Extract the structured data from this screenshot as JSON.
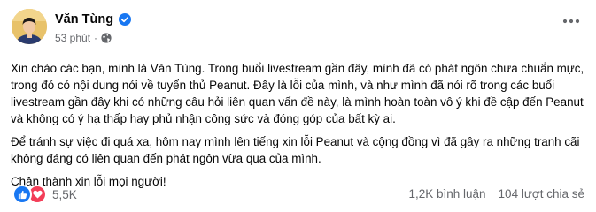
{
  "post": {
    "author": "Văn Tùng",
    "time": "53 phút",
    "separator": "·",
    "paragraphs": [
      "Xin chào các bạn, mình là Văn Tùng. Trong buổi livestream gần đây, mình đã có phát ngôn chưa chuẩn mực, trong đó có nội dung nói về tuyển thủ Peanut. Đây là lỗi của mình, và như mình đã nói rõ trong các buổi livestream gần đây khi có những câu hỏi liên quan vấn đề này, là mình hoàn toàn vô ý khi đề cập đến Peanut và không có ý hạ thấp hay phủ nhận công sức và đóng góp của bất kỳ ai.",
      "Để tránh sự việc đi quá xa, hôm nay mình lên tiếng xin lỗi Peanut và cộng đồng vì đã gây ra những tranh cãi không đáng có liên quan đến phát ngôn vừa qua của mình.",
      "Chân thành xin lỗi mọi người!"
    ]
  },
  "footer": {
    "reaction_count": "5,5K",
    "comments": "1,2K bình luận",
    "shares": "104 lượt chia sẻ"
  },
  "icons": {
    "verified": "verified-badge-icon",
    "privacy": "globe-icon",
    "more": "more-options-icon",
    "like": "like-reaction-icon",
    "love": "love-reaction-icon"
  },
  "colors": {
    "facebook_blue": "#1877f2",
    "love_red": "#f33e58",
    "secondary_text": "#65676b",
    "primary_text": "#050505"
  }
}
